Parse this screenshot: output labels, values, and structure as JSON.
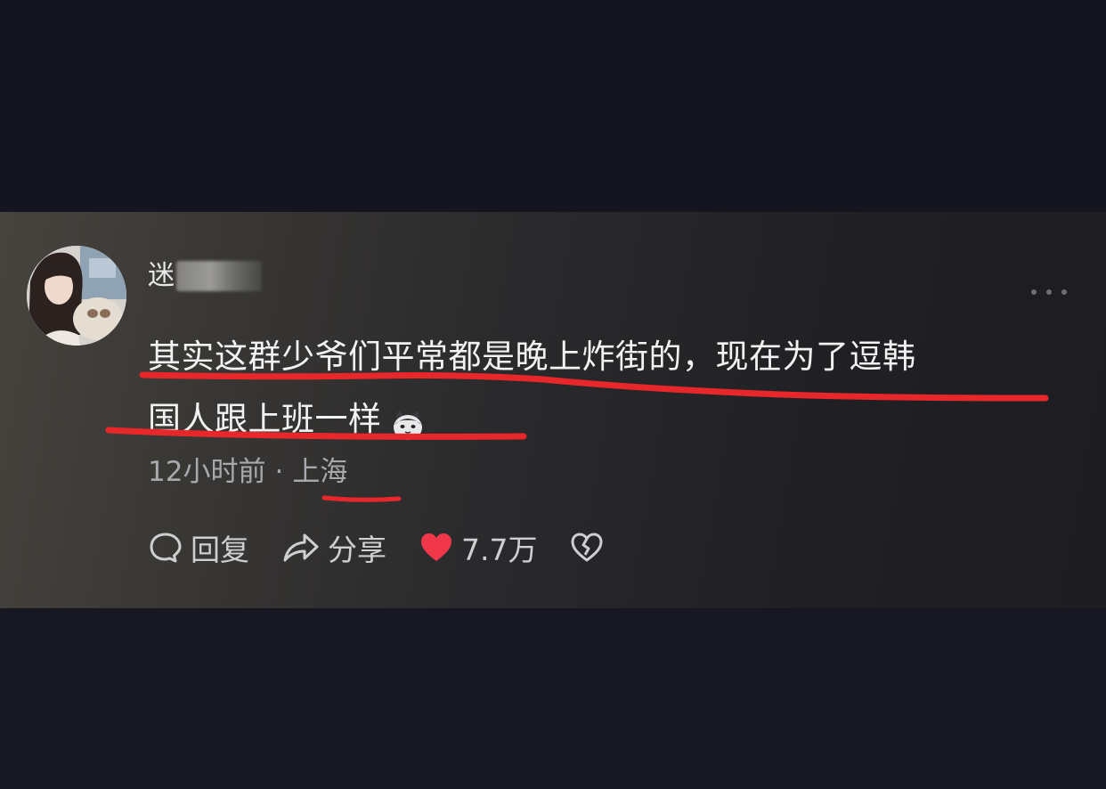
{
  "comment": {
    "username": "迷",
    "text_line1": "其实这群少爷们平常都是晚上炸街的，现在为了逗韩",
    "text_line2": "国人跟上班一样",
    "emoji": "cat-face",
    "time": "12小时前",
    "separator": "·",
    "location": "上海"
  },
  "actions": {
    "reply_label": "回复",
    "share_label": "分享",
    "like_count": "7.7万"
  },
  "colors": {
    "highlight_red": "#e8272a",
    "like_red": "#f0384a"
  },
  "icons": {
    "more": "more-dots-icon",
    "reply": "speech-bubble-icon",
    "share": "share-arrow-icon",
    "like": "heart-filled-icon",
    "dislike": "broken-heart-icon"
  }
}
